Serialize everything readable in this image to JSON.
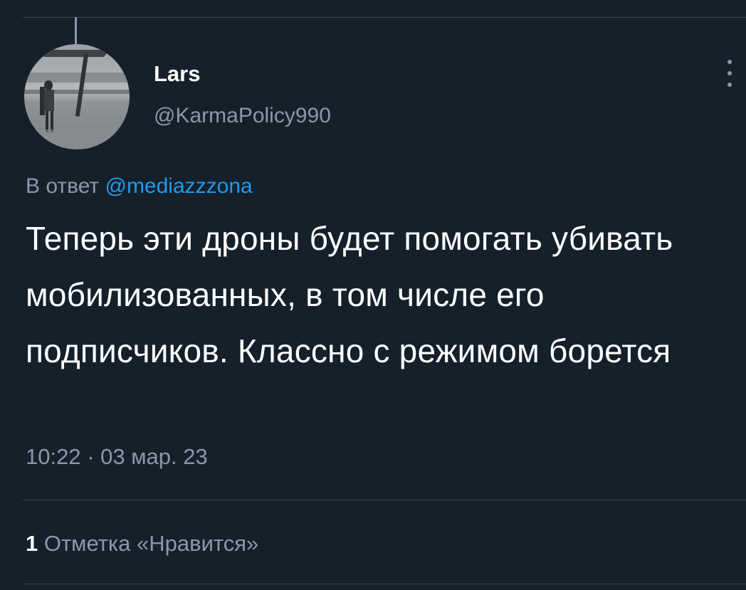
{
  "author": {
    "display_name": "Lars",
    "handle": "@KarmaPolicy990"
  },
  "reply": {
    "prefix": "В ответ",
    "mention": "@mediazzzona"
  },
  "tweet": {
    "text": "Теперь эти дроны будет помогать убивать мобилизованных, в том числе его подписчиков. Классно с режимом борется",
    "timestamp": "10:22 · 03 мар. 23"
  },
  "stats": {
    "likes_count": "1",
    "likes_label": "Отметка «Нравится»"
  },
  "icons": {
    "more": "more-vertical-icon"
  },
  "colors": {
    "background": "#15202b",
    "text_primary": "#ffffff",
    "text_secondary": "#8b98a5",
    "link": "#1d9bf0",
    "divider": "#38444d"
  }
}
